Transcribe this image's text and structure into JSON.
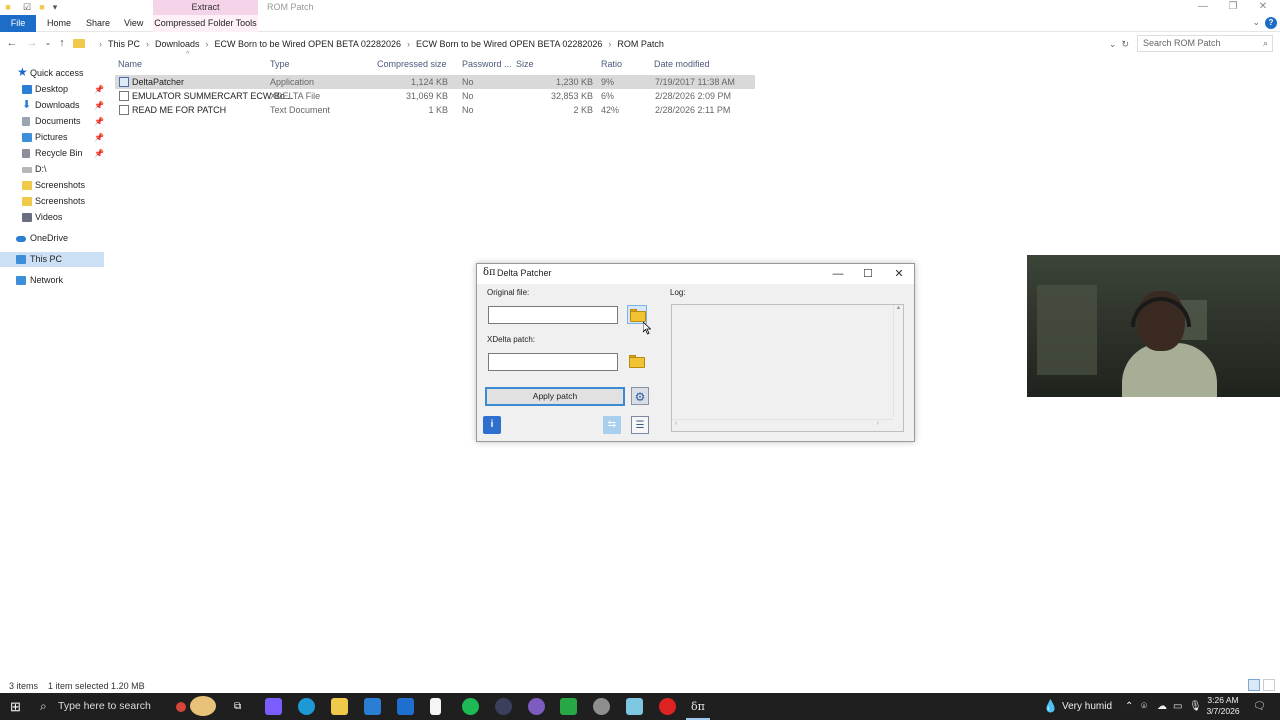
{
  "window": {
    "context_tab": "Extract",
    "title": "ROM Patch",
    "minimize": "—",
    "maximize": "❐",
    "close": "✕"
  },
  "ribbon": {
    "file": "File",
    "home": "Home",
    "share": "Share",
    "view": "View",
    "compressed_folder_tools": "Compressed Folder Tools"
  },
  "address": {
    "breadcrumbs": [
      "This PC",
      "Downloads",
      "ECW Born to be Wired OPEN BETA 02282026",
      "ECW Born to be Wired OPEN BETA 02282026",
      "ROM Patch"
    ],
    "search_placeholder": "Search ROM Patch"
  },
  "nav": {
    "items": [
      {
        "label": "Quick access",
        "icon": "star-icon",
        "color": "#1c6dc8"
      },
      {
        "label": "Desktop",
        "icon": "desktop-icon",
        "color": "#2a7fd4",
        "pinned": true
      },
      {
        "label": "Downloads",
        "icon": "download-icon",
        "color": "#2a7fd4",
        "pinned": true
      },
      {
        "label": "Documents",
        "icon": "document-icon",
        "color": "#9aa4b2",
        "pinned": true
      },
      {
        "label": "Pictures",
        "icon": "pictures-icon",
        "color": "#3d8fd9",
        "pinned": true
      },
      {
        "label": "Recycle Bin",
        "icon": "recycle-bin-icon",
        "color": "#8a8f99",
        "pinned": true
      },
      {
        "label": "D:\\",
        "icon": "drive-icon",
        "color": "#b7b7b7"
      },
      {
        "label": "Screenshots",
        "icon": "folder-icon",
        "color": "#f0c94a"
      },
      {
        "label": "Screenshots",
        "icon": "folder-icon",
        "color": "#f0c94a"
      },
      {
        "label": "Videos",
        "icon": "videos-icon",
        "color": "#6a6f80"
      },
      {
        "label": "OneDrive",
        "icon": "onedrive-icon",
        "color": "#2a7fd4"
      },
      {
        "label": "This PC",
        "icon": "computer-icon",
        "color": "#3d8fd9"
      },
      {
        "label": "Network",
        "icon": "network-icon",
        "color": "#3d8fd9"
      }
    ]
  },
  "files": {
    "columns": [
      "Name",
      "Type",
      "Compressed size",
      "Password ...",
      "Size",
      "Ratio",
      "Date modified"
    ],
    "rows": [
      {
        "name": "DeltaPatcher",
        "type": "Application",
        "compressed": "1,124 KB",
        "password": "No",
        "size": "1,230 KB",
        "ratio": "9%",
        "date": "7/19/2017 11:38 AM",
        "selected": true
      },
      {
        "name": "EMULATOR SUMMERCART ECW Bo...",
        "type": "XDELTA File",
        "compressed": "31,069 KB",
        "password": "No",
        "size": "32,853 KB",
        "ratio": "6%",
        "date": "2/28/2026 2:09 PM",
        "selected": false
      },
      {
        "name": "READ ME FOR PATCH",
        "type": "Text Document",
        "compressed": "1 KB",
        "password": "No",
        "size": "2 KB",
        "ratio": "42%",
        "date": "2/28/2026 2:11 PM",
        "selected": false
      }
    ]
  },
  "status": {
    "items": "3 items",
    "selection": "1 item selected  1.20 MB"
  },
  "dialog": {
    "icon": "δπ",
    "title": "Delta Patcher",
    "original_label": "Original file:",
    "original_value": "",
    "xdelta_label": "XDelta patch:",
    "xdelta_value": "",
    "apply": "Apply patch",
    "log_label": "Log:",
    "close": "✕",
    "maximize": "☐",
    "minimize": "—"
  },
  "taskbar": {
    "search_placeholder": "Type here to search",
    "weather": "Very humid",
    "time": "3:26 AM",
    "date": "3/7/2026"
  }
}
